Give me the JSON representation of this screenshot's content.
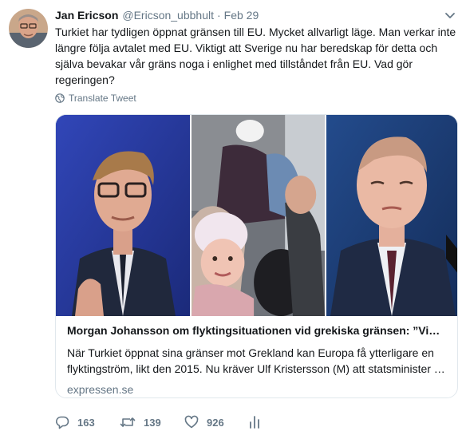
{
  "author": {
    "name": "Jan Ericson",
    "handle": "@Ericson_ubbhult",
    "separator": "·",
    "date": "Feb 29"
  },
  "tweet": {
    "text": "Turkiet har tydligen öppnat gränsen till EU. Mycket allvarligt läge. Man verkar inte längre följa avtalet med EU. Viktigt att Sverige nu har beredskap för detta och själva bevakar vår gräns noga i enlighet med tillståndet från EU. Vad gör regeringen?",
    "translate_label": "Translate Tweet"
  },
  "card": {
    "title": "Morgan Johansson om flyktingsituationen vid grekiska gränsen: ”Vi…",
    "description": "När Turkiet öppnat sina gränser mot Grekland kan Europa få ytterligare en flyktingström, likt den 2015. Nu kräver Ulf Kristersson (M) att statsminister …",
    "domain": "expressen.se"
  },
  "actions": {
    "replies": "163",
    "retweets": "139",
    "likes": "926"
  },
  "icons": {
    "caret": "chevron-down-icon",
    "globe": "globe-icon",
    "reply": "reply-icon",
    "retweet": "retweet-icon",
    "like": "heart-icon",
    "analytics": "analytics-icon"
  },
  "colors": {
    "text": "#14171a",
    "secondary": "#657786",
    "border": "#e1e8ed"
  }
}
